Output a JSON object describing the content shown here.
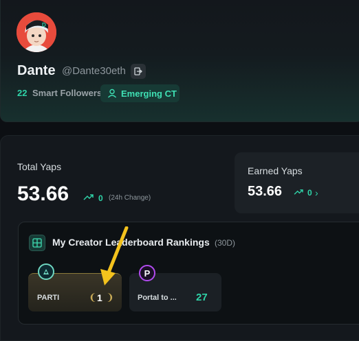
{
  "profile": {
    "display_name": "Dante",
    "handle": "@Dante30eth",
    "smart_followers_count": "22",
    "smart_followers_label": "Smart Followers",
    "tier_label": "Emerging CT",
    "icons": {
      "logout": "logout-icon",
      "tier": "user-icon"
    }
  },
  "stats": {
    "total_label": "Total Yaps",
    "total_value": "53.66",
    "total_change": "0",
    "total_change_period": "(24h Change)",
    "earned_label": "Earned Yaps",
    "earned_value": "53.66",
    "earned_change": "0",
    "icons": {
      "trend": "trending-up-icon",
      "more": "chevron-right-icon"
    }
  },
  "leaderboard": {
    "title": "My Creator Leaderboard Rankings",
    "period": "(30D)",
    "items": [
      {
        "name": "PARTI",
        "rank": "1",
        "highlight": true
      },
      {
        "name": "Portal to ...",
        "rank": "27",
        "highlight": false
      }
    ],
    "icons": {
      "header": "leaderboard-grid-icon",
      "rank_decoration": "laurel-icon"
    }
  },
  "colors": {
    "accent": "#2fd3a8",
    "gold": "#c9ab57",
    "background": "#0c0f13",
    "annotation_arrow": "#f3c21d"
  }
}
